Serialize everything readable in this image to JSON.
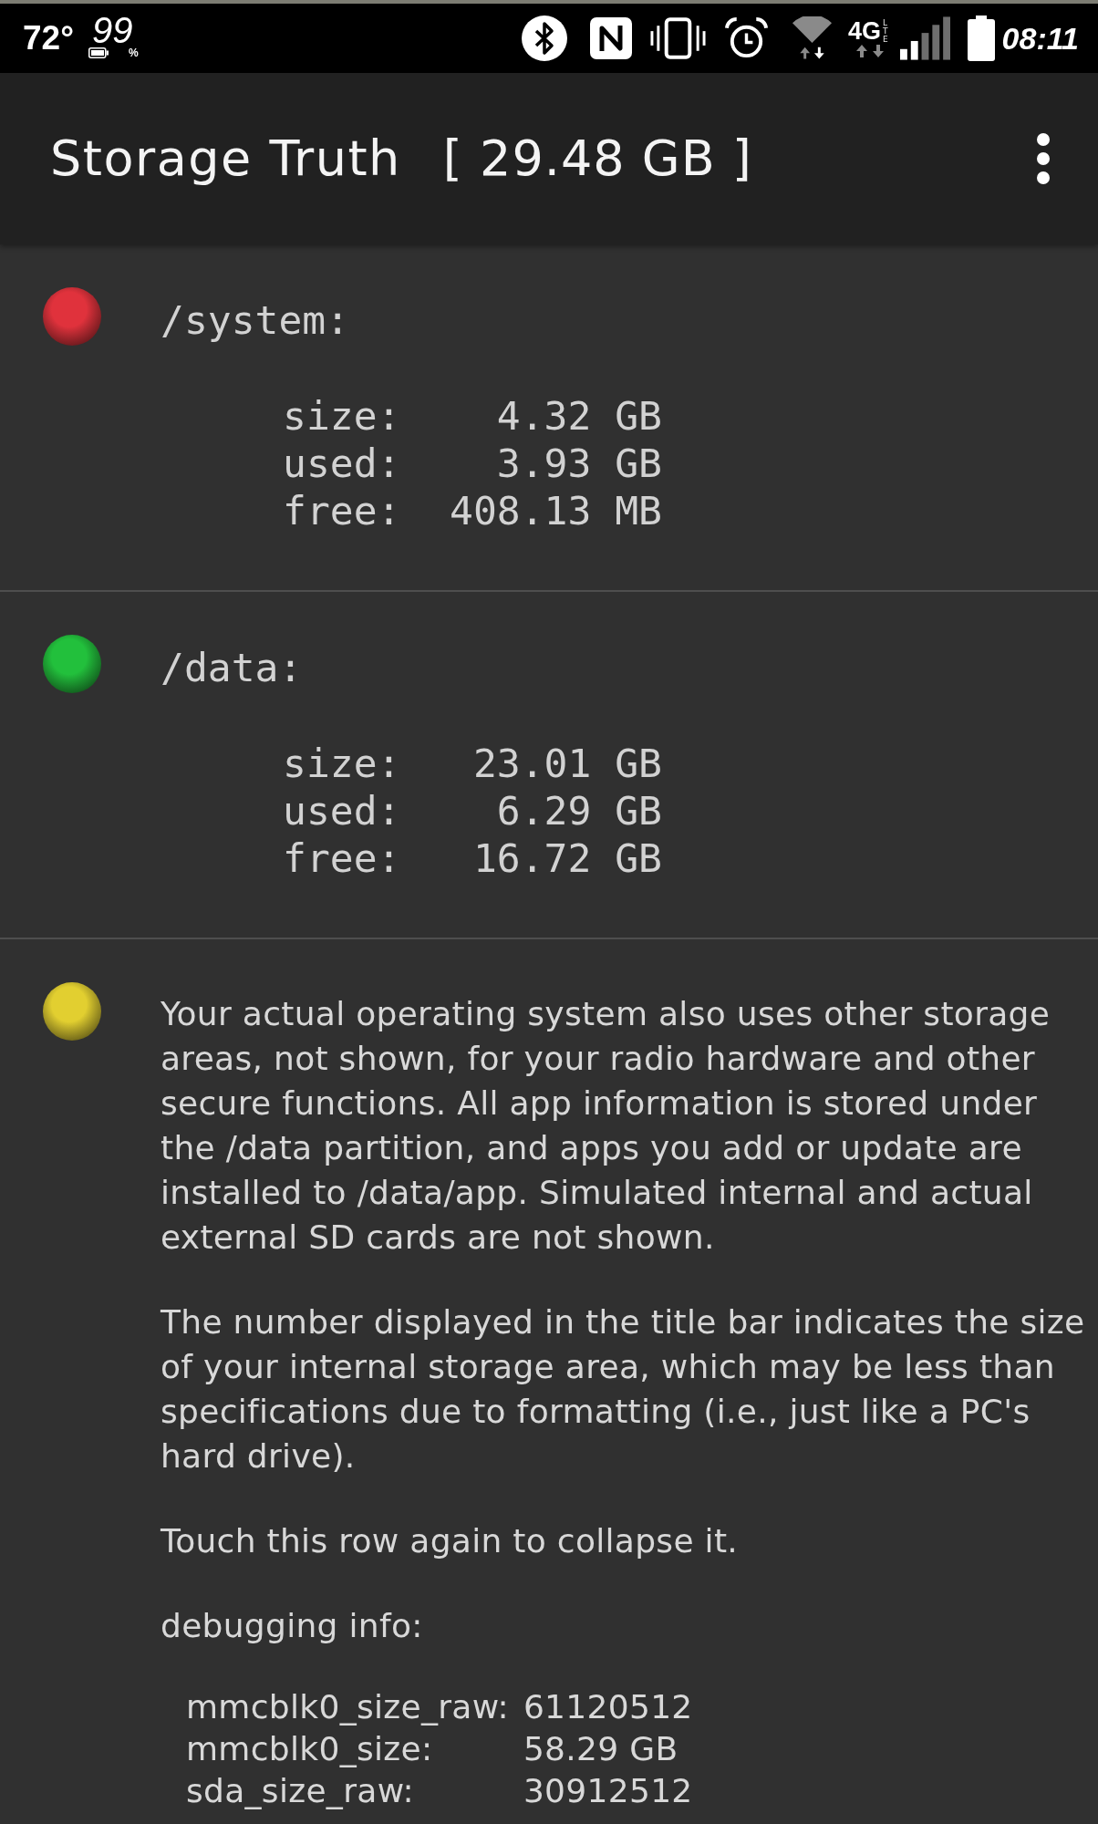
{
  "status_bar": {
    "temperature": "72°",
    "battery_percent": "99",
    "percent_sign": "%",
    "network_type": "4G",
    "network_subtype": "LTE",
    "time": "08:11"
  },
  "app_bar": {
    "title": "Storage Truth",
    "storage_size": "[ 29.48 GB ]"
  },
  "rows": [
    {
      "kind": "partition",
      "color": "#e0323c",
      "label": "/system:",
      "stats": [
        {
          "label": "size:",
          "value": "4.32 GB"
        },
        {
          "label": "used:",
          "value": "3.93 GB"
        },
        {
          "label": "free:",
          "value": "408.13 MB"
        }
      ]
    },
    {
      "kind": "partition",
      "color": "#22c03c",
      "label": "/data:",
      "stats": [
        {
          "label": "size:",
          "value": "23.01 GB"
        },
        {
          "label": "used:",
          "value": "6.29 GB"
        },
        {
          "label": "free:",
          "value": "16.72 GB"
        }
      ]
    },
    {
      "kind": "info",
      "color": "#e2cf30",
      "paragraphs": [
        "Your actual operating system also uses other storage areas, not shown, for your radio hardware and other secure functions. All app information is stored under the /data partition, and apps you add or update are installed to /data/app. Simulated internal and actual external SD cards are not shown.",
        "The number displayed in the title bar indicates the size of your internal storage area, which may be less than specifications due to formatting (i.e., just like a PC's hard drive).",
        "Touch this row again to collapse it."
      ],
      "debug_heading": "debugging info:",
      "debug_lines": [
        {
          "label": "mmcblk0_size_raw:",
          "value": "61120512"
        },
        {
          "label": "mmcblk0_size:",
          "value": "58.29 GB"
        },
        {
          "label": "sda_size_raw:",
          "value": "30912512"
        }
      ]
    }
  ]
}
